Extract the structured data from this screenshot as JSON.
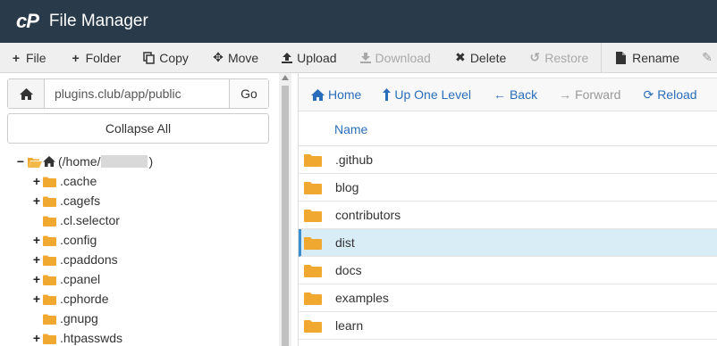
{
  "app": {
    "logo": "cP",
    "title": "File Manager"
  },
  "toolbar": {
    "file": "File",
    "folder": "Folder",
    "copy": "Copy",
    "move": "Move",
    "upload": "Upload",
    "download": "Download",
    "delete": "Delete",
    "restore": "Restore",
    "rename": "Rename"
  },
  "path": {
    "value": "plugins.club/app/public",
    "go_label": "Go"
  },
  "collapse_label": "Collapse All",
  "tree": {
    "root_prefix": "(/home/",
    "root_suffix": ")",
    "items": [
      {
        "label": ".cache",
        "expandable": true
      },
      {
        "label": ".cagefs",
        "expandable": true
      },
      {
        "label": ".cl.selector",
        "expandable": false
      },
      {
        "label": ".config",
        "expandable": true
      },
      {
        "label": ".cpaddons",
        "expandable": true
      },
      {
        "label": ".cpanel",
        "expandable": true
      },
      {
        "label": ".cphorde",
        "expandable": true
      },
      {
        "label": ".gnupg",
        "expandable": false
      },
      {
        "label": ".htpasswds",
        "expandable": true
      }
    ]
  },
  "nav": {
    "home": "Home",
    "up": "Up One Level",
    "back": "Back",
    "forward": "Forward",
    "reload": "Reload"
  },
  "table": {
    "name_header": "Name",
    "rows": [
      ".github",
      "blog",
      "contributors",
      "dist",
      "docs",
      "examples",
      "learn"
    ],
    "selected_row": "dist"
  },
  "colors": {
    "titlebar": "#293a4a",
    "folder": "#f0a830",
    "link": "#2a6ebb",
    "selected_row": "#d9edf7"
  }
}
